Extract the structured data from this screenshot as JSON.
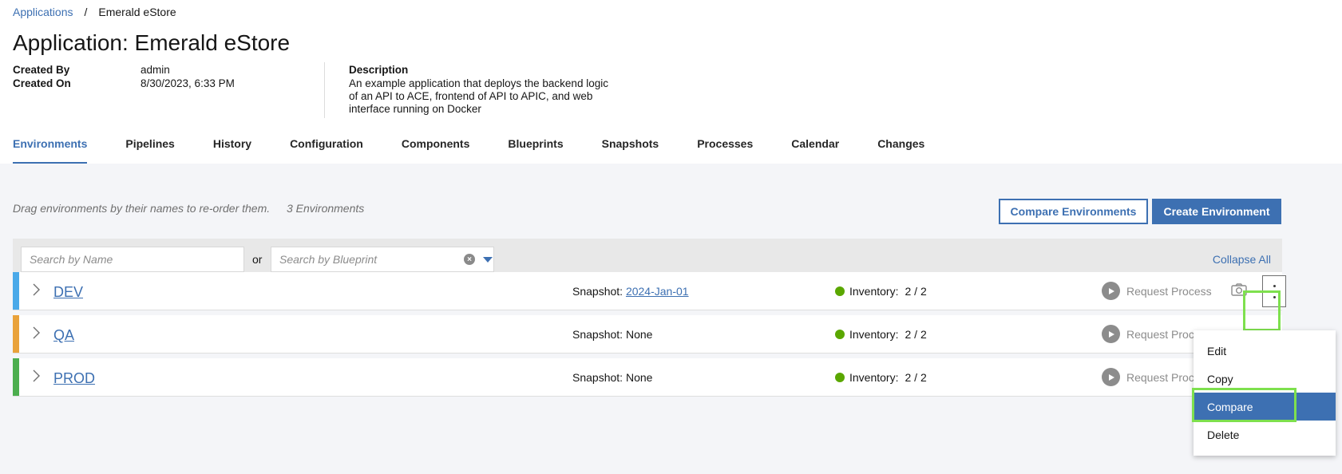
{
  "breadcrumb": {
    "parent": "Applications",
    "separator": "/",
    "current": "Emerald eStore"
  },
  "page": {
    "title": "Application: Emerald eStore"
  },
  "meta": {
    "created_by_label": "Created By",
    "created_by": "admin",
    "created_on_label": "Created On",
    "created_on": "8/30/2023, 6:33 PM",
    "description_label": "Description",
    "description": "An example application that deploys the backend logic of an API to ACE, frontend of API to APIC, and web interface running on Docker"
  },
  "tabs": [
    {
      "label": "Environments",
      "active": true
    },
    {
      "label": "Pipelines"
    },
    {
      "label": "History"
    },
    {
      "label": "Configuration"
    },
    {
      "label": "Components"
    },
    {
      "label": "Blueprints"
    },
    {
      "label": "Snapshots"
    },
    {
      "label": "Processes"
    },
    {
      "label": "Calendar"
    },
    {
      "label": "Changes"
    }
  ],
  "toolbar": {
    "hint": "Drag environments by their names to re-order them.",
    "count": "3 Environments",
    "compare_label": "Compare Environments",
    "create_label": "Create Environment"
  },
  "filters": {
    "search_name_placeholder": "Search by Name",
    "or": "or",
    "search_blueprint_placeholder": "Search by Blueprint",
    "collapse_all": "Collapse All"
  },
  "environments": [
    {
      "name": "DEV",
      "color": "#4aa9e9",
      "snapshot_label": "Snapshot:",
      "snapshot": "2024-Jan-01",
      "inventory_label": "Inventory:",
      "inventory": "2 / 2",
      "request_label": "Request Process"
    },
    {
      "name": "QA",
      "color": "#e9a23b",
      "snapshot_label": "Snapshot:",
      "snapshot": "None",
      "inventory_label": "Inventory:",
      "inventory": "2 / 2",
      "request_label": "Request Process"
    },
    {
      "name": "PROD",
      "color": "#4cae4f",
      "snapshot_label": "Snapshot:",
      "snapshot": "None",
      "inventory_label": "Inventory:",
      "inventory": "2 / 2",
      "request_label": "Request Process"
    }
  ],
  "context_menu": {
    "items": [
      "Edit",
      "Copy",
      "Compare",
      "Delete"
    ],
    "active": "Compare"
  },
  "colors": {
    "accent": "#3d70b2",
    "status_ok": "#5aa700",
    "highlight": "#7ee04e"
  }
}
